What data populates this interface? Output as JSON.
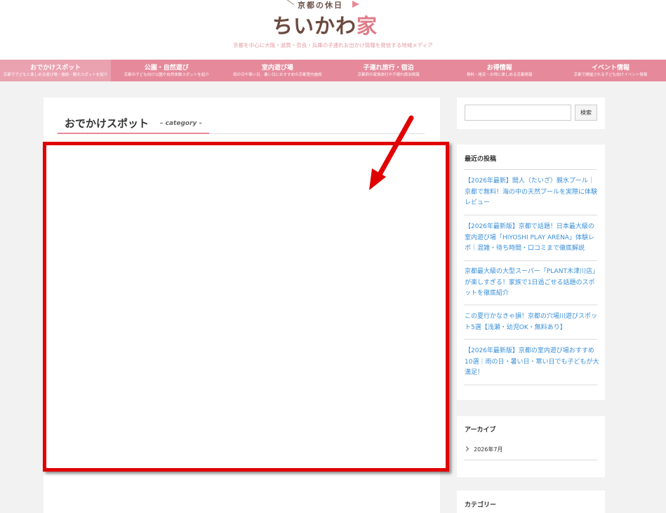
{
  "header": {
    "logo_small": "京都の休日",
    "logo_main_a": "ちいかわ",
    "logo_main_b": "家",
    "tagline": "京都を中心に大阪・滋賀・奈良・兵庫の子連れお出かけ情報を発信する地域メディア"
  },
  "nav": [
    {
      "title": "おでかけスポット",
      "sub": "京都で子どもと楽しめる遊び場・施設・観光スポットを紹介"
    },
    {
      "title": "公園・自然遊び",
      "sub": "京都の子ども向け公園や自然体験スポットを紹介"
    },
    {
      "title": "室内遊び場",
      "sub": "雨の日や寒い日、暑い日におすすめの京都室内施設"
    },
    {
      "title": "子連れ旅行・宿泊",
      "sub": "京都府の家族旅行や子連れ宿泊情報"
    },
    {
      "title": "お得情報",
      "sub": "無料・格安・お得に楽しめる京都情報"
    },
    {
      "title": "イベント情報",
      "sub": "京都で開催される子ども向けイベント情報"
    }
  ],
  "main": {
    "category_title": "おでかけスポット",
    "category_label": "– category –"
  },
  "sidebar": {
    "search_placeholder": "",
    "search_button": "検索",
    "recent_title": "最近の投稿",
    "recent_posts": [
      "【2026年最新】間人（たいざ）親水プール｜京都で無料！海の中の天然プールを実際に体験レビュー",
      "【2026年最新版】京都で話題！日本最大級の室内遊び場「HIYOSHI PLAY ARENA」体験レポ｜混雑・待ち時間・口コミまで徹底解説",
      "京都最大級の大型スーパー「PLANT木津川店」が楽しすぎる！家族で1日過ごせる話題のスポットを徹底紹介",
      "この夏行かなきゃ損！京都の穴場川遊びスポット5選【浅瀬・幼児OK・無料あり】",
      "【2026年最新版】京都の室内遊び場おすすめ10選｜雨の日・暑い日・寒い日でも子どもが大満足！"
    ],
    "archive_title": "アーカイブ",
    "archive_item": "2026年7月",
    "category_title": "カテゴリー"
  },
  "colors": {
    "nav_bg": "#e6899b",
    "nav_active": "#eaa1b0",
    "link": "#3a8fd8",
    "highlight": "#e00000"
  }
}
